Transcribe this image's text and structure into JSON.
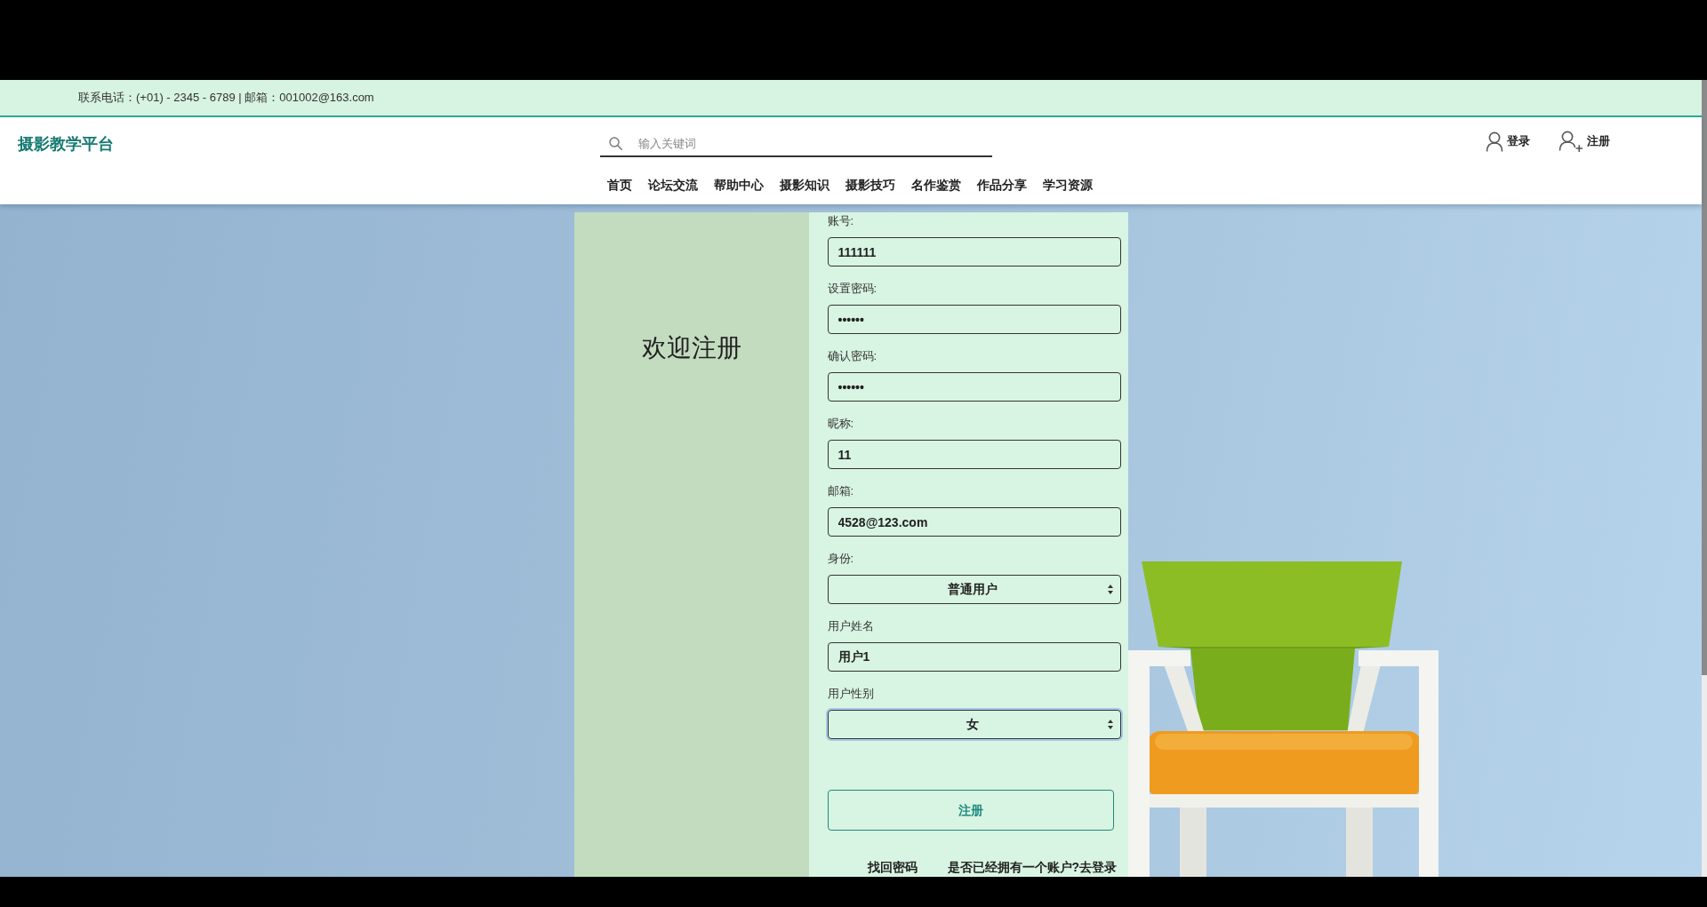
{
  "top_bar": {
    "contact": "联系电话：(+01) - 2345 - 6789 | 邮箱：001002@163.com"
  },
  "header": {
    "logo": "摄影教学平台",
    "search": {
      "placeholder": "输入关键词"
    },
    "account_links": [
      {
        "kind": "login",
        "label": "登录"
      },
      {
        "kind": "register",
        "label": "注册"
      }
    ]
  },
  "nav": [
    "首页",
    "论坛交流",
    "帮助中心",
    "摄影知识",
    "摄影技巧",
    "名作鉴赏",
    "作品分享",
    "学习资源"
  ],
  "register_panel": {
    "welcome": "欢迎注册",
    "fields": [
      {
        "label": "账号:",
        "kind": "input",
        "value": "111111",
        "focused": false
      },
      {
        "label": "设置密码:",
        "kind": "input",
        "value": "••••••",
        "focused": false
      },
      {
        "label": "确认密码:",
        "kind": "input",
        "value": "••••••",
        "focused": false
      },
      {
        "label": "昵称:",
        "kind": "input",
        "value": "11",
        "focused": false
      },
      {
        "label": "邮箱:",
        "kind": "input",
        "value": "4528@123.com",
        "focused": false
      },
      {
        "label": "身份:",
        "kind": "select",
        "value": "普通用户",
        "focused": false
      },
      {
        "label": "用户姓名",
        "kind": "input",
        "value": "用户1",
        "focused": false
      },
      {
        "label": "用户性别",
        "kind": "select",
        "value": "女",
        "focused": true
      }
    ],
    "submit": "注册",
    "links": [
      "找回密码",
      "是否已经拥有一个账户?去登录"
    ]
  }
}
